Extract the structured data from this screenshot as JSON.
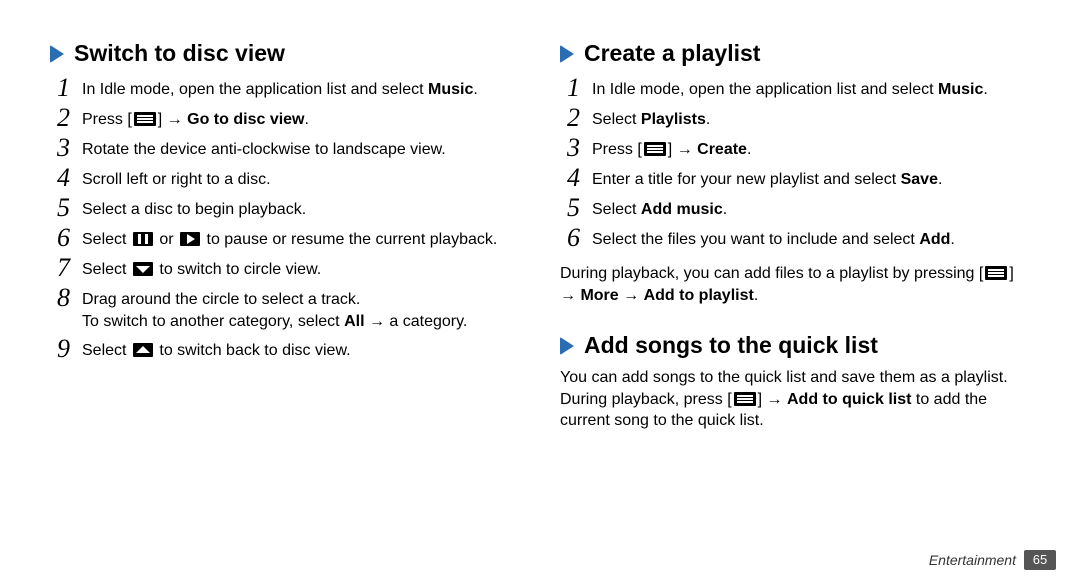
{
  "left": {
    "heading1": "Switch to disc view",
    "steps1": {
      "s1a": "In Idle mode, open the application list and select ",
      "s1b": "Music",
      "s1c": ".",
      "s2a": "Press [",
      "s2b": "] → ",
      "s2c": "Go to disc view",
      "s2d": ".",
      "s3": "Rotate the device anti-clockwise to landscape view.",
      "s4": "Scroll left or right to a disc.",
      "s5": "Select a disc to begin playback.",
      "s6a": "Select ",
      "s6b": " or ",
      "s6c": " to pause or resume the current playback.",
      "s7a": "Select ",
      "s7b": " to switch to circle view.",
      "s8": "Drag around the circle to select a track.",
      "s8x1": "To switch to another category, select ",
      "s8x2": "All",
      "s8x3": " → a category.",
      "s9a": "Select ",
      "s9b": " to switch back to disc view."
    }
  },
  "right": {
    "heading1": "Create a playlist",
    "steps1": {
      "s1a": "In Idle mode, open the application list and select ",
      "s1b": "Music",
      "s1c": ".",
      "s2a": "Select ",
      "s2b": "Playlists",
      "s2c": ".",
      "s3a": "Press [",
      "s3b": "] → ",
      "s3c": "Create",
      "s3d": ".",
      "s4a": "Enter a title for your new playlist and select ",
      "s4b": "Save",
      "s4c": ".",
      "s5a": "Select ",
      "s5b": "Add music",
      "s5c": ".",
      "s6a": "Select the files you want to include and select ",
      "s6b": "Add",
      "s6c": "."
    },
    "after1a": "During playback, you can add files to a playlist by pressing [",
    "after1b": "] → ",
    "after1c": "More",
    "after1d": " → ",
    "after1e": "Add to playlist",
    "after1f": ".",
    "heading2": "Add songs to the quick list",
    "after2a": "You can add songs to the quick list and save them as a playlist. During playback, press [",
    "after2b": "] → ",
    "after2c": "Add to quick list",
    "after2d": " to add the current song to the quick list."
  },
  "footer": {
    "section": "Entertainment",
    "page": "65"
  }
}
